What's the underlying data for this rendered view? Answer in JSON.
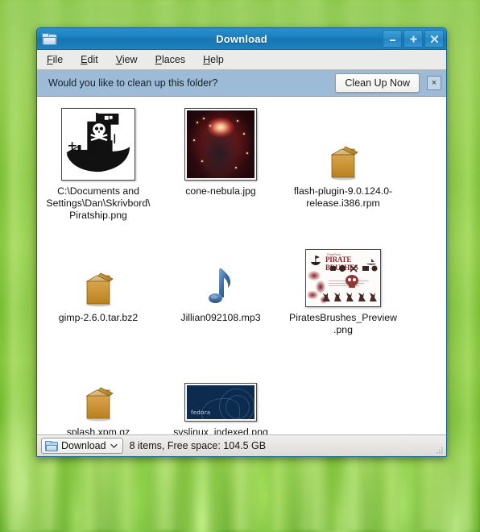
{
  "window": {
    "title": "Download",
    "titlebar_icon": "folder-icon",
    "controls": {
      "minimize": "−",
      "maximize": "+",
      "close": "×"
    }
  },
  "menubar": {
    "items": [
      {
        "mnemonic": "F",
        "rest": "ile",
        "name": "file"
      },
      {
        "mnemonic": "E",
        "rest": "dit",
        "name": "edit"
      },
      {
        "mnemonic": "V",
        "rest": "iew",
        "name": "view"
      },
      {
        "mnemonic": "P",
        "rest": "laces",
        "name": "places"
      },
      {
        "mnemonic": "H",
        "rest": "elp",
        "name": "help"
      }
    ]
  },
  "infobar": {
    "message": "Would you like to clean up this folder?",
    "button_label": "Clean Up Now",
    "close_label": "×"
  },
  "files": [
    {
      "name": "C:\\Documents and Settings\\Dan\\Skrivbord\\Piratship.png",
      "icon": "image-thumbnail-pirateship",
      "type": "image"
    },
    {
      "name": "cone-nebula.jpg",
      "icon": "image-thumbnail-nebula",
      "type": "image"
    },
    {
      "name": "flash-plugin-9.0.124.0-release.i386.rpm",
      "icon": "package-icon",
      "type": "package"
    },
    {
      "name": "gimp-2.6.0.tar.bz2",
      "icon": "package-icon",
      "type": "archive"
    },
    {
      "name": "Jillian092108.mp3",
      "icon": "music-note-icon",
      "type": "audio"
    },
    {
      "name": "PiratesBrushes_Preview.png",
      "icon": "image-thumbnail-brushes",
      "type": "image"
    },
    {
      "name": "splash.xpm.gz",
      "icon": "package-icon",
      "type": "archive"
    },
    {
      "name": "syslinux_indexed.png",
      "icon": "image-thumbnail-syslinux",
      "type": "image"
    }
  ],
  "thumbnails": {
    "brushes": {
      "title": "PIRATE BRUSHES",
      "supertitle": "PiratePack",
      "subtitle": "for the Gimp"
    },
    "syslinux": {
      "brand": "fedora"
    }
  },
  "statusbar": {
    "path_label": "Download",
    "path_icon": "folder-icon",
    "dropdown_icon": "chevron-down-icon",
    "status": "8 items, Free space: 104.5 GB"
  },
  "colors": {
    "titlebar_blue": "#1b80c0",
    "infobar_blue": "#9dbad6",
    "window_border": "#14608f",
    "package_orange": "#c8912f",
    "music_blue": "#3a6ea5",
    "desktop_green": "#8cc63f"
  }
}
